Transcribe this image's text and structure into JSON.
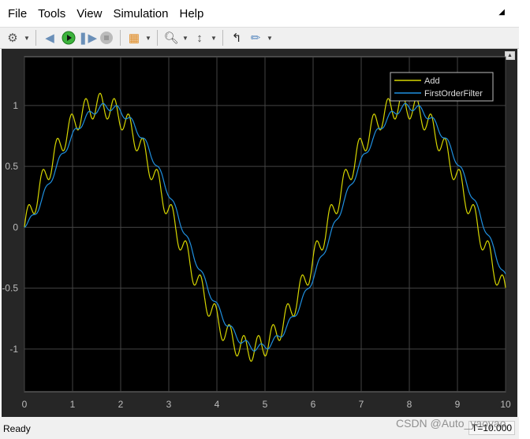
{
  "menu": [
    "File",
    "Tools",
    "View",
    "Simulation",
    "Help"
  ],
  "toolbar": {
    "icons": [
      "gear-icon",
      "step-back-icon",
      "run-icon",
      "step-forward-icon",
      "stop-icon",
      "signal-select-icon",
      "zoom-icon",
      "autoscale-icon",
      "trigger-icon",
      "measure-icon"
    ]
  },
  "status": {
    "text": "Ready",
    "time": "T=10.000"
  },
  "watermark": "CSDN @Auto_yaoyao",
  "colors": {
    "add": "#d6d600",
    "filter": "#1f8fdf",
    "background": "#000000"
  },
  "chart_data": {
    "type": "line",
    "xlim": [
      0,
      10
    ],
    "ylim": [
      -1.35,
      1.4
    ],
    "xticks": [
      "0",
      "1",
      "2",
      "3",
      "4",
      "5",
      "6",
      "7",
      "8",
      "9",
      "10"
    ],
    "yticks": [
      {
        "v": 1,
        "label": "1"
      },
      {
        "v": 0.5,
        "label": "0.5"
      },
      {
        "v": 0,
        "label": "0"
      },
      {
        "v": -0.5,
        "label": "-0.5"
      },
      {
        "v": -1,
        "label": "-1"
      }
    ],
    "grid": true,
    "legend": "top-right",
    "x": [
      0,
      1,
      2,
      3,
      4,
      5,
      6,
      7,
      8,
      9,
      10
    ],
    "series": [
      {
        "name": "Add",
        "values": [
          0,
          0.85,
          0.95,
          0.15,
          -0.75,
          -1.0,
          -0.3,
          0.65,
          1.0,
          0.4,
          -0.63
        ]
      },
      {
        "name": "FirstOrderFilter",
        "values": [
          0,
          0.75,
          0.95,
          0.3,
          -0.65,
          -0.95,
          -0.45,
          0.55,
          1.0,
          0.5,
          -0.4
        ]
      }
    ]
  }
}
